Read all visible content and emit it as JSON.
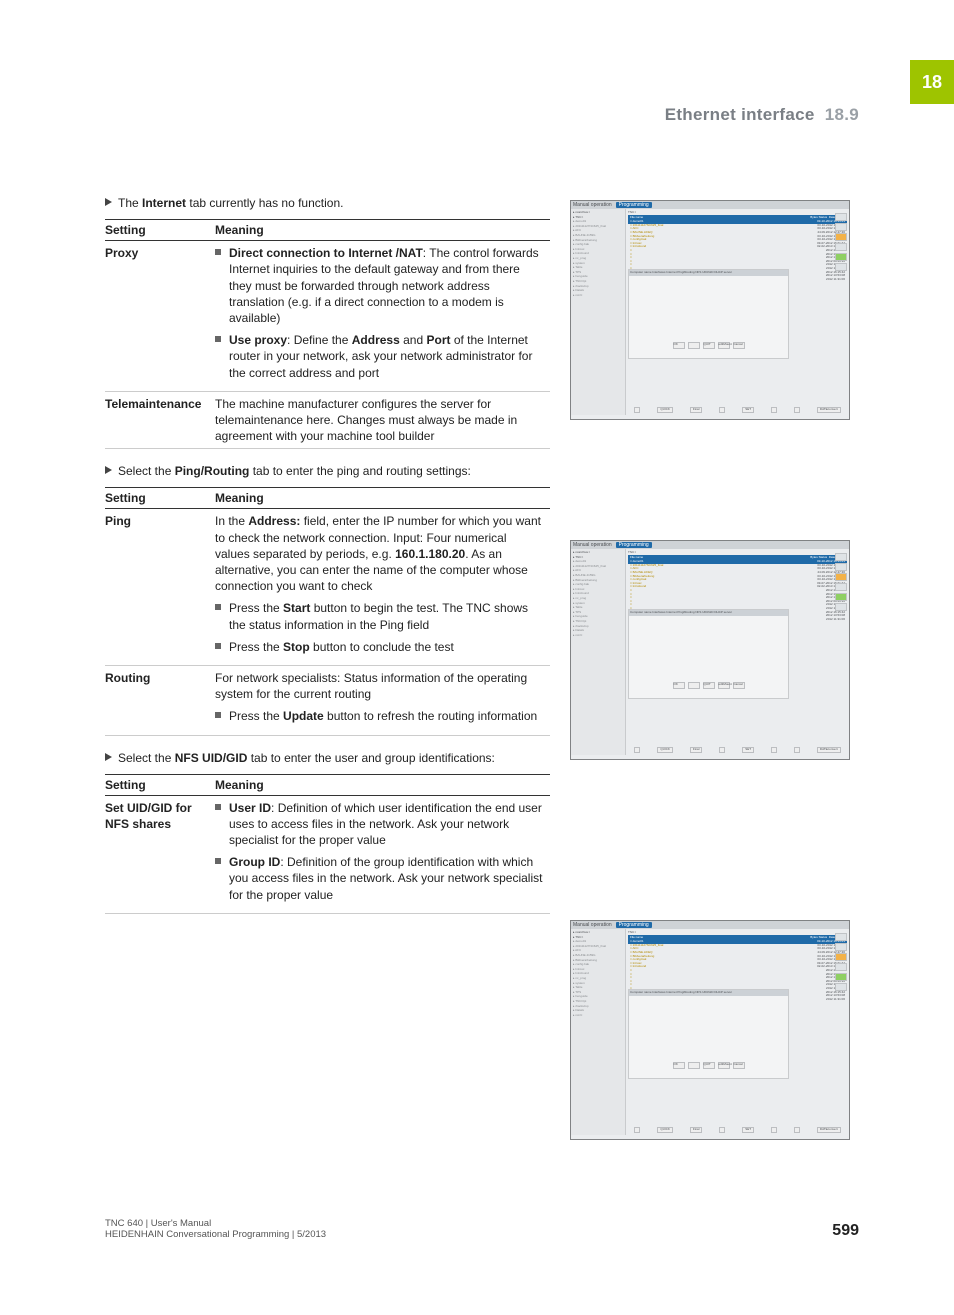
{
  "sideTab": "18",
  "runningHead": {
    "text": "Ethernet interface",
    "num": "18.9"
  },
  "leads": {
    "internet": "The <b>Internet</b> tab currently has no function.",
    "pingRouting": "Select the <b>Ping/Routing</b> tab to enter the ping and routing settings:",
    "nfs": "Select the <b>NFS UID/GID</b> tab to enter the user and group identifications:"
  },
  "headers": {
    "setting": "Setting",
    "meaning": "Meaning"
  },
  "table1": [
    {
      "k": "Proxy",
      "items": [
        "<b>Direct connection to Internet /NAT</b>: The control forwards Internet inquiries to the default gateway and from there they must be forwarded through network address translation (e.g. if a direct connection to a modem is available)",
        "<b>Use proxy</b>: Define the <b>Address</b> and <b>Port</b> of the Internet router in your network, ask your network administrator for the correct address and port"
      ]
    },
    {
      "k": "Telemaintenance",
      "v": "The machine manufacturer configures the server for telemaintenance here. Changes must always be made in agreement with your machine tool builder"
    }
  ],
  "table2": [
    {
      "k": "Ping",
      "v": "In the <b>Address:</b> field, enter the IP number for which you want to check the network connection. Input: Four numerical values separated by periods, e.g. <b>160.1.180.20</b>. As an alternative, you can enter the name of the computer whose connection you want to check",
      "items": [
        "Press the <b>Start</b> button to begin the test. The TNC shows the status information in the Ping field",
        "Press the <b>Stop</b> button to conclude the test"
      ]
    },
    {
      "k": "Routing",
      "v": "For network specialists: Status information of the operating system for the current routing",
      "items": [
        "Press the <b>Update</b> button to refresh the routing information"
      ]
    }
  ],
  "table3": [
    {
      "k": "Set UID/GID for NFS shares",
      "items": [
        "<b>User ID</b>: Definition of which user identification the end user uses to access files in the network. Ask your network specialist for the proper value",
        "<b>Group ID</b>: Definition of the group identification with which you access files in the network. Ask your network specialist for the proper value"
      ]
    }
  ],
  "shots": {
    "modeLeft": "Manual operation",
    "modeRight": "Programming",
    "path": "TNC:\\",
    "fileHeader": {
      "c1": "File name",
      "c2": "Bytes",
      "c3": "Status",
      "c4": "Date",
      "c5": "Time"
    },
    "dir": [
      "ncarchive:\\",
      "TNC:\\",
      "demo01",
      "201111127NC625_final",
      "AFC",
      "BAUNE.4159G",
      "Bildverarbeitung",
      "config.bak",
      "Introsc",
      "Introfound",
      "nc_prog",
      "system",
      "Table",
      "TPS",
      "henguide",
      "TNCOpt",
      "rbackufup",
      "DataG",
      "ncnlt:"
    ],
    "files": [
      {
        "n": "demo01",
        "d": "03-10-2012",
        "t": "16:15:41"
      },
      {
        "n": "201111127NC625_final",
        "d": "03-10-2012",
        "t": "11:32:37"
      },
      {
        "n": "AFC",
        "d": "03-10-2012",
        "t": "11:32:18"
      },
      {
        "n": "BAUNE.LIFEQ",
        "d": "24.09.2012",
        "t": "12:47:30"
      },
      {
        "n": "Bildverarbeitung",
        "d": "03-10-2012",
        "t": "11:32:18"
      },
      {
        "n": "config.bak",
        "d": "03-10-2012",
        "t": "11:32:12"
      },
      {
        "n": "Introsc",
        "d": "09-07-2012",
        "t": "16:31:44"
      },
      {
        "n": "Introfound",
        "d": "02-02-2013",
        "t": "17:09:30"
      },
      {
        "n": "",
        "d": "2012",
        "t": "15:39:31"
      },
      {
        "n": "",
        "d": "2012",
        "t": "16:31:44"
      },
      {
        "n": "",
        "d": "2012",
        "t": "13:53:06"
      },
      {
        "n": "",
        "d": "2012",
        "t": "09:46:36"
      },
      {
        "n": "",
        "d": "2012",
        "t": "11:18:23"
      },
      {
        "n": "",
        "d": "2012",
        "t": "11:32:21"
      },
      {
        "n": "",
        "d": "2012",
        "t": "16:15:42"
      },
      {
        "n": "",
        "d": "2012",
        "t": "13:53:08"
      },
      {
        "n": "",
        "d": "2012",
        "t": "11:31:06"
      }
    ],
    "tabs": [
      "Computer name",
      "Interfaces",
      "Internet",
      "Ping/Routing",
      "NFS UID/GID",
      "DHCP server"
    ],
    "btns": [
      "OK",
      "",
      "QUIT",
      "editMount",
      "Cancel"
    ],
    "softkeys": [
      "",
      "QUICK",
      "Final",
      "",
      "SET",
      "",
      "",
      "DATEconvert"
    ]
  },
  "footer": {
    "l1": "TNC 640 | User's Manual",
    "l2": "HEIDENHAIN Conversational Programming | 5/2013",
    "page": "599"
  }
}
